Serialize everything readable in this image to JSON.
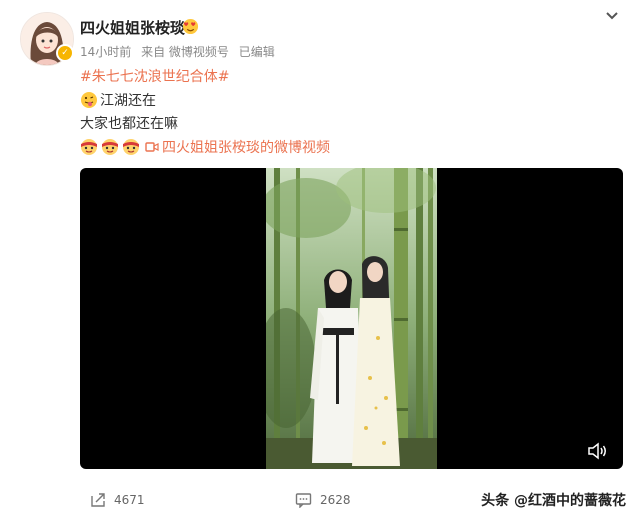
{
  "post": {
    "username": "四火姐姐张桉琰",
    "meta": {
      "time": "14小时前",
      "source": "来自 微博视频号",
      "edited": "已编辑"
    },
    "hashtag": "#朱七七沈浪世纪合体#",
    "line1_text": "江湖还在",
    "line2_text": "大家也都还在嘛",
    "video_link_text": "四火姐姐张桉琰的微博视频"
  },
  "stats": {
    "reposts": "4671",
    "comments": "2628"
  },
  "watermark": "头条 @红酒中的蔷薇花",
  "icons": {
    "more": "chevron-down-icon",
    "repost": "repost-icon",
    "comment": "comment-icon",
    "volume": "volume-icon",
    "video": "video-camera-icon",
    "verified": "verified-badge-icon"
  },
  "colors": {
    "link": "#eb7350",
    "badge": "#f7b500",
    "video_bg": "#000000"
  }
}
